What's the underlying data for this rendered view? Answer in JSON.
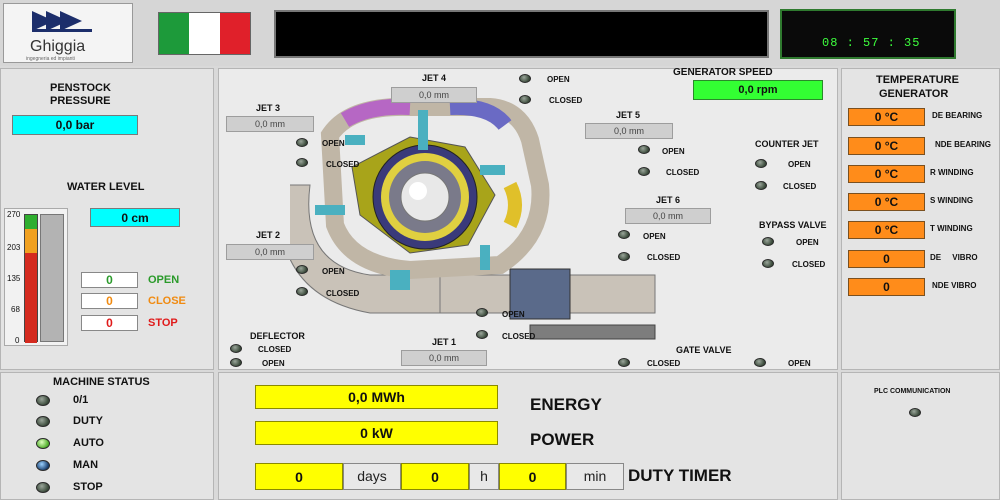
{
  "header": {
    "logo_text": "Ghiggia",
    "logo_sub": "ingegneria ed impianti",
    "clock": "08 : 57 : 35"
  },
  "left": {
    "penstock_title_1": "PENSTOCK",
    "penstock_title_2": "PRESSURE",
    "penstock_value": "0,0 bar",
    "water_level_title": "WATER LEVEL",
    "water_level_value": "0 cm",
    "scale_ticks": [
      "270",
      "203",
      "135",
      "68",
      "0"
    ],
    "open_value": "0",
    "open_label": "OPEN",
    "close_value": "0",
    "close_label": "CLOSE",
    "stop_value": "0",
    "stop_label": "STOP"
  },
  "center": {
    "jet4": {
      "label": "JET 4",
      "value": "0,0 mm"
    },
    "jet3": {
      "label": "JET 3",
      "value": "0,0 mm"
    },
    "jet5": {
      "label": "JET 5",
      "value": "0,0 mm"
    },
    "jet6": {
      "label": "JET 6",
      "value": "0,0 mm"
    },
    "jet2": {
      "label": "JET 2",
      "value": "0,0 mm"
    },
    "jet1": {
      "label": "JET 1",
      "value": "0,0 mm"
    },
    "open": "OPEN",
    "closed": "CLOSED",
    "generator_speed_title": "GENERATOR SPEED",
    "generator_speed_value": "0,0 rpm",
    "counter_jet": "COUNTER JET",
    "bypass_valve": "BYPASS VALVE",
    "deflector": "DEFLECTOR",
    "gate_valve": "GATE VALVE"
  },
  "right": {
    "title_1": "TEMPERATURE",
    "title_2": "GENERATOR",
    "rows": [
      {
        "value": "0 °C",
        "label": "DE BEARING"
      },
      {
        "value": "0 °C",
        "label": "NDE BEARING"
      },
      {
        "value": "0 °C",
        "label": "R WINDING"
      },
      {
        "value": "0 °C",
        "label": "S WINDING"
      },
      {
        "value": "0 °C",
        "label": "T WINDING"
      },
      {
        "value": "0",
        "label": "DE     VIBRO"
      },
      {
        "value": "0",
        "label": "NDE VIBRO"
      }
    ],
    "plc": "PLC COMMUNICATION"
  },
  "status": {
    "title": "MACHINE STATUS",
    "items": [
      "0/1",
      "DUTY",
      "AUTO",
      "MAN",
      "STOP"
    ]
  },
  "bottom": {
    "energy_value": "0,0 MWh",
    "energy_label": "ENERGY",
    "power_value": "0 kW",
    "power_label": "POWER",
    "days_value": "0",
    "days_unit": "days",
    "hours_value": "0",
    "hours_unit": "h",
    "min_value": "0",
    "min_unit": "min",
    "duty_label": "DUTY TIMER"
  },
  "colors": {
    "accent_cyan": "#00ffff",
    "accent_green": "#33ff33",
    "accent_yellow": "#ffff00",
    "accent_orange": "#ff8c1a"
  }
}
